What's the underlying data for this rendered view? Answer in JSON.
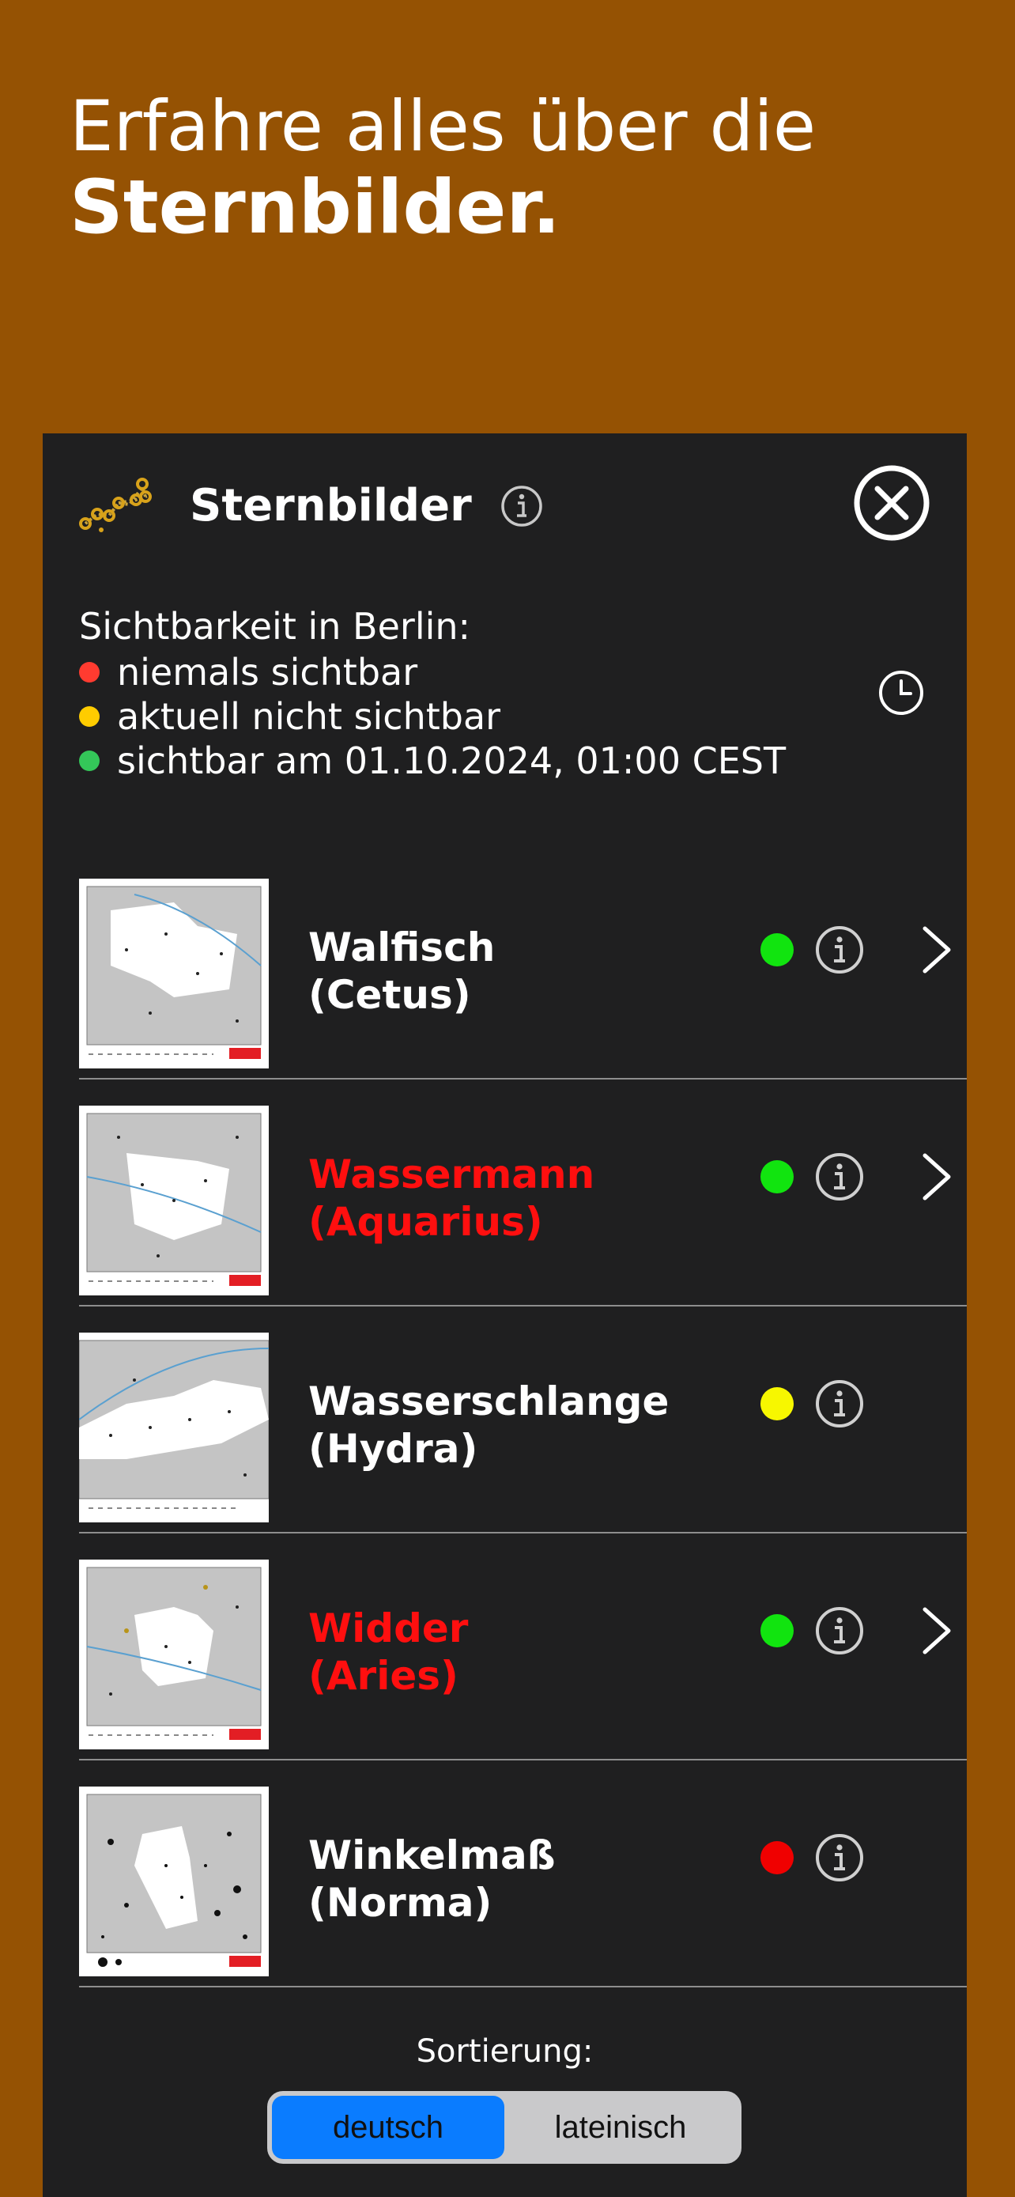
{
  "hero": {
    "line1": "Erfahre alles über die",
    "line2": "Sternbilder."
  },
  "panel": {
    "title": "Sternbilder",
    "logo_icon": "constellation-icon",
    "info_icon": "info-icon",
    "close_icon": "close-circle-icon"
  },
  "visibility": {
    "title": "Sichtbarkeit in Berlin:",
    "legend": [
      {
        "color": "#ff3b30",
        "text": "niemals sichtbar"
      },
      {
        "color": "#ffcc00",
        "text": "aktuell nicht sichtbar"
      },
      {
        "color": "#34c759",
        "text": "sichtbar am 01.10.2024, 01:00 CEST"
      }
    ],
    "time_icon": "clock-icon"
  },
  "constellations": [
    {
      "name_de": "Walfisch",
      "name_lat": "(Cetus)",
      "highlight": false,
      "status_color": "#11e40f",
      "has_detail": true
    },
    {
      "name_de": "Wassermann",
      "name_lat": "(Aquarius)",
      "highlight": true,
      "status_color": "#11e40f",
      "has_detail": true
    },
    {
      "name_de": "Wasserschlange",
      "name_lat": "(Hydra)",
      "highlight": false,
      "status_color": "#f7f700",
      "has_detail": false
    },
    {
      "name_de": "Widder",
      "name_lat": "(Aries)",
      "highlight": true,
      "status_color": "#11e40f",
      "has_detail": true
    },
    {
      "name_de": "Winkelmaß",
      "name_lat": "(Norma)",
      "highlight": false,
      "status_color": "#f00000",
      "has_detail": false
    }
  ],
  "sorting": {
    "label": "Sortierung:",
    "options": [
      "deutsch",
      "lateinisch"
    ],
    "selected": "deutsch"
  },
  "colors": {
    "background": "#955203",
    "panel": "#1f1f20",
    "highlight_text": "#ff0f0f",
    "segment_active": "#0a7cff"
  }
}
